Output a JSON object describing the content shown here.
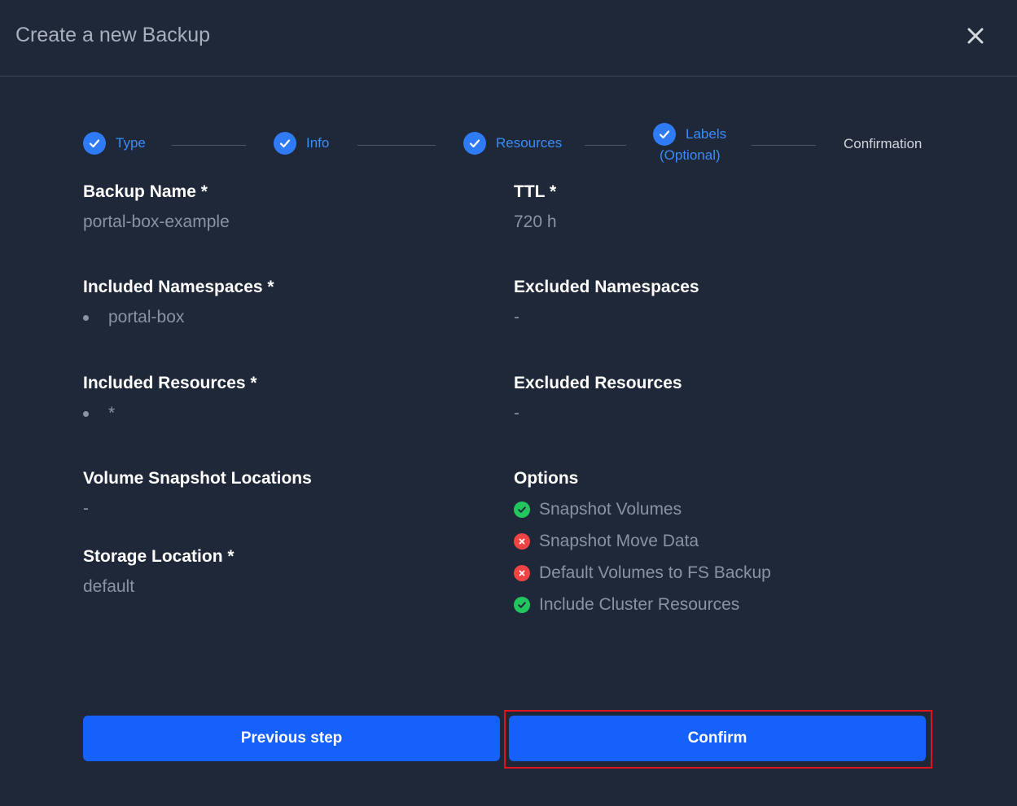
{
  "dialog": {
    "title": "Create a new Backup"
  },
  "icons": {
    "close": "close-icon",
    "step_done": "checkmark-icon",
    "option_enabled": "check-circle-icon",
    "option_disabled": "x-circle-icon"
  },
  "stepper": {
    "steps": [
      {
        "label": "Type",
        "status": "done"
      },
      {
        "label": "Info",
        "status": "done"
      },
      {
        "label": "Resources",
        "status": "done"
      },
      {
        "label_line1": "Labels",
        "label_line2": "(Optional)",
        "status": "done"
      },
      {
        "label": "Confirmation",
        "status": "current"
      }
    ]
  },
  "fields": {
    "backup_name": {
      "label": "Backup Name *",
      "value": "portal-box-example"
    },
    "ttl": {
      "label": "TTL *",
      "value": "720 h"
    },
    "included_namespaces": {
      "label": "Included Namespaces *",
      "items": [
        "portal-box"
      ]
    },
    "excluded_namespaces": {
      "label": "Excluded Namespaces",
      "value": "-"
    },
    "included_resources": {
      "label": "Included Resources *",
      "items": [
        "*"
      ]
    },
    "excluded_resources": {
      "label": "Excluded Resources",
      "value": "-"
    },
    "volume_snapshot_locations": {
      "label": "Volume Snapshot Locations",
      "value": "-"
    },
    "storage_location": {
      "label": "Storage Location *",
      "value": "default"
    },
    "options": {
      "label": "Options",
      "items": [
        {
          "label": "Snapshot Volumes",
          "enabled": true
        },
        {
          "label": "Snapshot Move Data",
          "enabled": false
        },
        {
          "label": "Default Volumes to FS Backup",
          "enabled": false
        },
        {
          "label": "Include Cluster Resources",
          "enabled": true
        }
      ]
    }
  },
  "actions": {
    "previous_label": "Previous step",
    "confirm_label": "Confirm"
  },
  "colors": {
    "background": "#1f2838",
    "primary": "#1660fb",
    "step_accent": "#3b8cf7",
    "success": "#22c55e",
    "danger": "#ef4444",
    "highlight": "#e0141e"
  }
}
